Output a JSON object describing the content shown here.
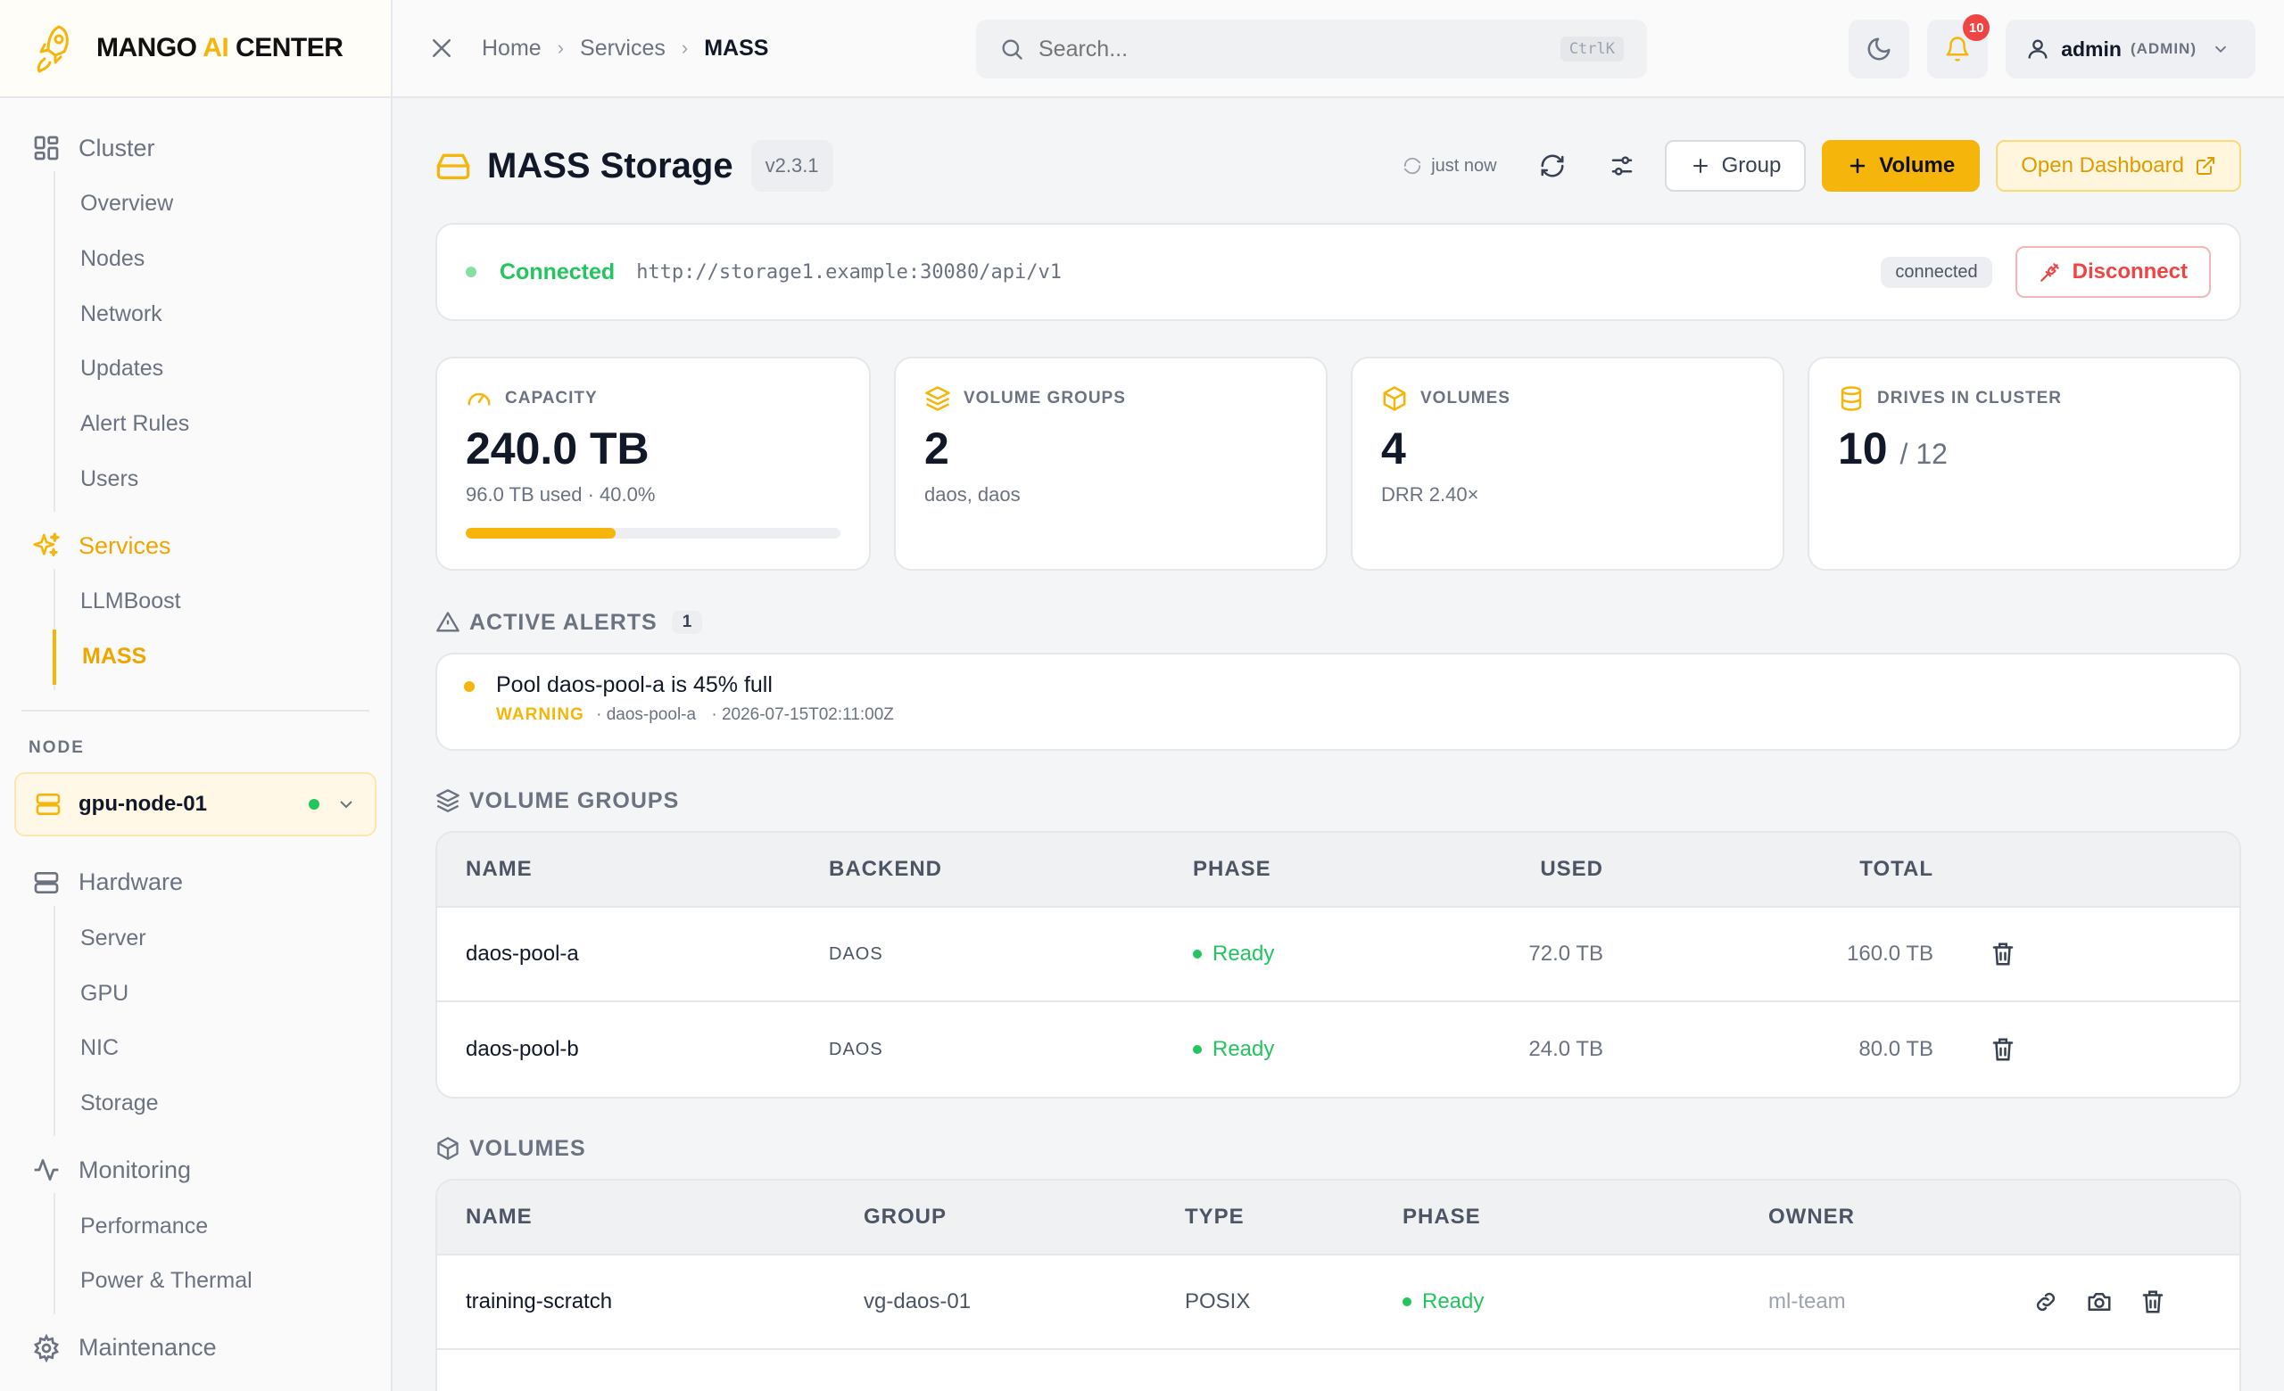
{
  "brand": {
    "name_part1": "MANGO ",
    "name_ai": "AI",
    "name_part2": " CENTER"
  },
  "sidebar": {
    "cluster": {
      "label": "Cluster",
      "items": [
        "Overview",
        "Nodes",
        "Network",
        "Updates",
        "Alert Rules",
        "Users"
      ]
    },
    "services": {
      "label": "Services",
      "items": [
        "LLMBoost",
        "MASS"
      ],
      "active": "MASS"
    },
    "node_label": "NODE",
    "node": {
      "name": "gpu-node-01"
    },
    "hardware": {
      "label": "Hardware",
      "items": [
        "Server",
        "GPU",
        "NIC",
        "Storage"
      ]
    },
    "monitoring": {
      "label": "Monitoring",
      "items": [
        "Performance",
        "Power & Thermal"
      ]
    },
    "maintenance": {
      "label": "Maintenance"
    }
  },
  "topbar": {
    "breadcrumb": [
      "Home",
      "Services",
      "MASS"
    ],
    "search_placeholder": "Search...",
    "search_shortcut": "CtrlK",
    "notification_count": "10",
    "user_name": "admin",
    "user_role": "(ADMIN)"
  },
  "page": {
    "title": "MASS Storage",
    "version": "v2.3.1",
    "refresh_label": "just now",
    "group_button": "Group",
    "volume_button": "Volume",
    "dashboard_button": "Open Dashboard"
  },
  "connection": {
    "status": "Connected",
    "url": "http://storage1.example:30080/api/v1",
    "pill": "connected",
    "disconnect_label": "Disconnect"
  },
  "stats": {
    "capacity": {
      "label": "CAPACITY",
      "value": "240.0 TB",
      "desc": "96.0 TB used · 40.0%",
      "used_pct": 40
    },
    "volume_groups": {
      "label": "VOLUME GROUPS",
      "value": "2",
      "desc": "daos, daos"
    },
    "volumes": {
      "label": "VOLUMES",
      "value": "4",
      "desc": "DRR 2.40×"
    },
    "drives": {
      "label": "DRIVES IN CLUSTER",
      "value": "10",
      "total": "/ 12"
    }
  },
  "alerts": {
    "label": "ACTIVE ALERTS",
    "count": "1",
    "items": [
      {
        "title": "Pool daos-pool-a is 45% full",
        "severity": "WARNING",
        "source": "· daos-pool-a",
        "time": "· 2026-07-15T02:11:00Z"
      }
    ]
  },
  "volume_groups": {
    "label": "VOLUME GROUPS",
    "columns": [
      "NAME",
      "BACKEND",
      "PHASE",
      "USED",
      "TOTAL"
    ],
    "rows": [
      {
        "name": "daos-pool-a",
        "backend": "DAOS",
        "phase": "Ready",
        "used": "72.0 TB",
        "total": "160.0 TB"
      },
      {
        "name": "daos-pool-b",
        "backend": "DAOS",
        "phase": "Ready",
        "used": "24.0 TB",
        "total": "80.0 TB"
      }
    ]
  },
  "volumes": {
    "label": "VOLUMES",
    "columns": [
      "NAME",
      "GROUP",
      "TYPE",
      "PHASE",
      "OWNER"
    ],
    "rows": [
      {
        "name": "training-scratch",
        "group": "vg-daos-01",
        "type": "POSIX",
        "phase": "Ready",
        "owner": "ml-team"
      }
    ]
  },
  "colors": {
    "accent": "#f5b50a",
    "success": "#22c55e",
    "danger": "#ef4444"
  },
  "icons": [
    "rocket-logo-icon",
    "grid-icon",
    "sparkle-icon",
    "server-icon",
    "activity-icon",
    "gear-icon",
    "search-icon",
    "moon-icon",
    "bell-icon",
    "user-icon",
    "hard-drive-icon",
    "refresh-icon",
    "sliders-icon",
    "plus-icon",
    "external-link-icon",
    "unplug-icon",
    "gauge-icon",
    "layers-icon",
    "cube-icon",
    "database-icon",
    "warning-triangle-icon",
    "trash-icon",
    "link-icon",
    "camera-icon",
    "close-icon",
    "chevron-down-icon"
  ]
}
